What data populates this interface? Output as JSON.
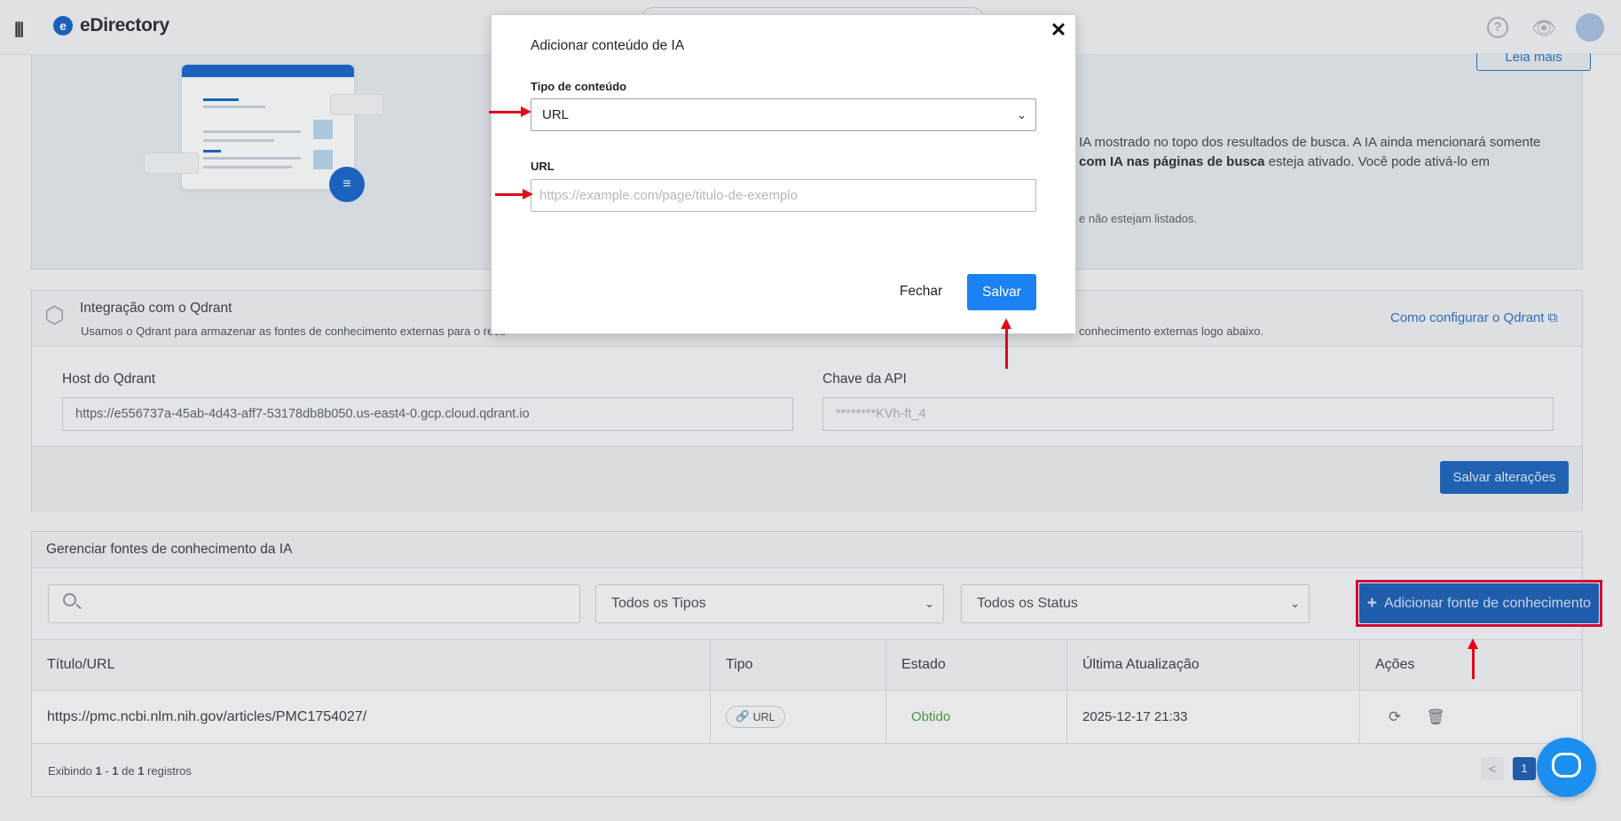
{
  "app": {
    "logo_mark": "e",
    "name": "eDirectory",
    "menu_icon": "hamburger-icon",
    "help_symbol": "?",
    "eye_symbol": "👁"
  },
  "ai_card": {
    "read_more_label": "Leia mais",
    "desc_line1": "IA mostrado no topo dos resultados de busca. A IA ainda mencionará somente",
    "desc_line2_bold": "com IA nas páginas de busca",
    "desc_line2_rest": " esteja ativado. Você pode ativá-lo em",
    "note": "e não estejam listados."
  },
  "qdrant": {
    "title": "Integração com o Qdrant",
    "subtitle_left": "Usamos o Qdrant para armazenar as fontes de conhecimento externas para o recu",
    "subtitle_right": "conhecimento externas logo abaixo.",
    "config_link": "Como configurar o Qdrant",
    "host_label": "Host do Qdrant",
    "host_value": "https://e556737a-45ab-4d43-aff7-53178db8b050.us-east4-0.gcp.cloud.qdrant.io",
    "api_key_label": "Chave da API",
    "api_key_value": "********KVh-ft_4",
    "save_changes_label": "Salvar alterações"
  },
  "sources": {
    "title": "Gerenciar fontes de conhecimento da IA",
    "type_filter": "Todos os Tipos",
    "status_filter": "Todos os Status",
    "add_button_label": "Adicionar fonte de conhecimento",
    "add_button_symbol": "+",
    "columns": {
      "title": "Título/URL",
      "type": "Tipo",
      "status": "Estado",
      "updated": "Última Atualização",
      "actions": "Ações"
    },
    "rows": [
      {
        "title": "https://pmc.ncbi.nlm.nih.gov/articles/PMC1754027/",
        "type": "URL",
        "status": "Obtido",
        "updated": "2025-12-17 21:33"
      }
    ],
    "footer_prefix": "Exibindo ",
    "footer_from": "1",
    "footer_dash": " - ",
    "footer_to": "1",
    "footer_of": " de ",
    "footer_total": "1",
    "footer_suffix": " registros",
    "pager_prev": "<",
    "current_page": "1"
  },
  "modal": {
    "title": "Adicionar conteúdo de IA",
    "content_type_label": "Tipo de conteúdo",
    "content_type_value": "URL",
    "url_label": "URL",
    "url_placeholder": "https://example.com/page/titulo-de-exemplo",
    "close_label": "Fechar",
    "save_label": "Salvar",
    "close_symbol": "✕"
  },
  "colors": {
    "primary": "#1a82f2",
    "brand_dark": "#1d64bd",
    "status_ok": "#4e9a3e",
    "annotation_red": "#e10a18"
  }
}
